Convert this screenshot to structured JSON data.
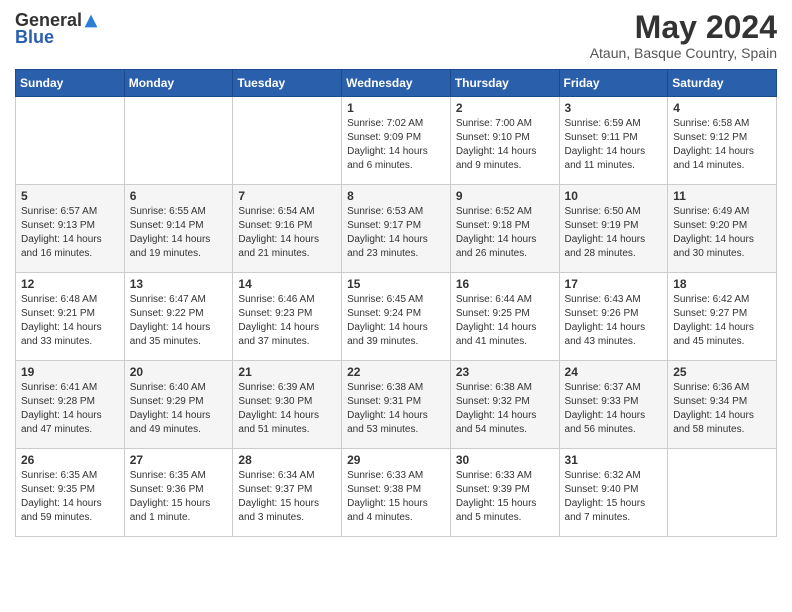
{
  "header": {
    "logo_general": "General",
    "logo_blue": "Blue",
    "month_year": "May 2024",
    "location": "Ataun, Basque Country, Spain"
  },
  "weekdays": [
    "Sunday",
    "Monday",
    "Tuesday",
    "Wednesday",
    "Thursday",
    "Friday",
    "Saturday"
  ],
  "weeks": [
    [
      {
        "day": "",
        "content": ""
      },
      {
        "day": "",
        "content": ""
      },
      {
        "day": "",
        "content": ""
      },
      {
        "day": "1",
        "content": "Sunrise: 7:02 AM\nSunset: 9:09 PM\nDaylight: 14 hours\nand 6 minutes."
      },
      {
        "day": "2",
        "content": "Sunrise: 7:00 AM\nSunset: 9:10 PM\nDaylight: 14 hours\nand 9 minutes."
      },
      {
        "day": "3",
        "content": "Sunrise: 6:59 AM\nSunset: 9:11 PM\nDaylight: 14 hours\nand 11 minutes."
      },
      {
        "day": "4",
        "content": "Sunrise: 6:58 AM\nSunset: 9:12 PM\nDaylight: 14 hours\nand 14 minutes."
      }
    ],
    [
      {
        "day": "5",
        "content": "Sunrise: 6:57 AM\nSunset: 9:13 PM\nDaylight: 14 hours\nand 16 minutes."
      },
      {
        "day": "6",
        "content": "Sunrise: 6:55 AM\nSunset: 9:14 PM\nDaylight: 14 hours\nand 19 minutes."
      },
      {
        "day": "7",
        "content": "Sunrise: 6:54 AM\nSunset: 9:16 PM\nDaylight: 14 hours\nand 21 minutes."
      },
      {
        "day": "8",
        "content": "Sunrise: 6:53 AM\nSunset: 9:17 PM\nDaylight: 14 hours\nand 23 minutes."
      },
      {
        "day": "9",
        "content": "Sunrise: 6:52 AM\nSunset: 9:18 PM\nDaylight: 14 hours\nand 26 minutes."
      },
      {
        "day": "10",
        "content": "Sunrise: 6:50 AM\nSunset: 9:19 PM\nDaylight: 14 hours\nand 28 minutes."
      },
      {
        "day": "11",
        "content": "Sunrise: 6:49 AM\nSunset: 9:20 PM\nDaylight: 14 hours\nand 30 minutes."
      }
    ],
    [
      {
        "day": "12",
        "content": "Sunrise: 6:48 AM\nSunset: 9:21 PM\nDaylight: 14 hours\nand 33 minutes."
      },
      {
        "day": "13",
        "content": "Sunrise: 6:47 AM\nSunset: 9:22 PM\nDaylight: 14 hours\nand 35 minutes."
      },
      {
        "day": "14",
        "content": "Sunrise: 6:46 AM\nSunset: 9:23 PM\nDaylight: 14 hours\nand 37 minutes."
      },
      {
        "day": "15",
        "content": "Sunrise: 6:45 AM\nSunset: 9:24 PM\nDaylight: 14 hours\nand 39 minutes."
      },
      {
        "day": "16",
        "content": "Sunrise: 6:44 AM\nSunset: 9:25 PM\nDaylight: 14 hours\nand 41 minutes."
      },
      {
        "day": "17",
        "content": "Sunrise: 6:43 AM\nSunset: 9:26 PM\nDaylight: 14 hours\nand 43 minutes."
      },
      {
        "day": "18",
        "content": "Sunrise: 6:42 AM\nSunset: 9:27 PM\nDaylight: 14 hours\nand 45 minutes."
      }
    ],
    [
      {
        "day": "19",
        "content": "Sunrise: 6:41 AM\nSunset: 9:28 PM\nDaylight: 14 hours\nand 47 minutes."
      },
      {
        "day": "20",
        "content": "Sunrise: 6:40 AM\nSunset: 9:29 PM\nDaylight: 14 hours\nand 49 minutes."
      },
      {
        "day": "21",
        "content": "Sunrise: 6:39 AM\nSunset: 9:30 PM\nDaylight: 14 hours\nand 51 minutes."
      },
      {
        "day": "22",
        "content": "Sunrise: 6:38 AM\nSunset: 9:31 PM\nDaylight: 14 hours\nand 53 minutes."
      },
      {
        "day": "23",
        "content": "Sunrise: 6:38 AM\nSunset: 9:32 PM\nDaylight: 14 hours\nand 54 minutes."
      },
      {
        "day": "24",
        "content": "Sunrise: 6:37 AM\nSunset: 9:33 PM\nDaylight: 14 hours\nand 56 minutes."
      },
      {
        "day": "25",
        "content": "Sunrise: 6:36 AM\nSunset: 9:34 PM\nDaylight: 14 hours\nand 58 minutes."
      }
    ],
    [
      {
        "day": "26",
        "content": "Sunrise: 6:35 AM\nSunset: 9:35 PM\nDaylight: 14 hours\nand 59 minutes."
      },
      {
        "day": "27",
        "content": "Sunrise: 6:35 AM\nSunset: 9:36 PM\nDaylight: 15 hours\nand 1 minute."
      },
      {
        "day": "28",
        "content": "Sunrise: 6:34 AM\nSunset: 9:37 PM\nDaylight: 15 hours\nand 3 minutes."
      },
      {
        "day": "29",
        "content": "Sunrise: 6:33 AM\nSunset: 9:38 PM\nDaylight: 15 hours\nand 4 minutes."
      },
      {
        "day": "30",
        "content": "Sunrise: 6:33 AM\nSunset: 9:39 PM\nDaylight: 15 hours\nand 5 minutes."
      },
      {
        "day": "31",
        "content": "Sunrise: 6:32 AM\nSunset: 9:40 PM\nDaylight: 15 hours\nand 7 minutes."
      },
      {
        "day": "",
        "content": ""
      }
    ]
  ]
}
